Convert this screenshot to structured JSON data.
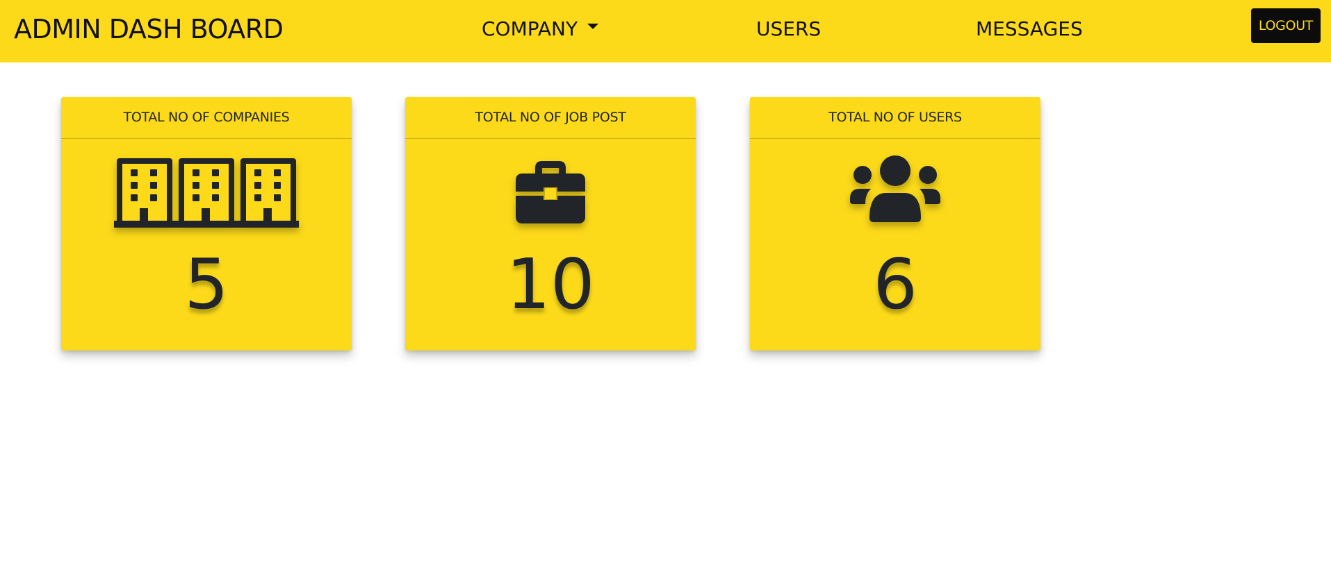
{
  "navbar": {
    "brand": "ADMIN DASH BOARD",
    "items": [
      {
        "label": "COMPANY",
        "has_dropdown": true
      },
      {
        "label": "USERS"
      },
      {
        "label": "MESSAGES"
      }
    ],
    "logout_label": "LOGOUT"
  },
  "cards": [
    {
      "title": "TOTAL NO OF COMPANIES",
      "icon": "buildings-icon",
      "value": "5"
    },
    {
      "title": "TOTAL NO OF JOB POST",
      "icon": "briefcase-icon",
      "value": "10"
    },
    {
      "title": "TOTAL NO OF USERS",
      "icon": "users-icon",
      "value": "6"
    }
  ],
  "colors": {
    "accent": "#fcda1a",
    "text": "#212529",
    "logout_bg": "#0c0c0c"
  }
}
